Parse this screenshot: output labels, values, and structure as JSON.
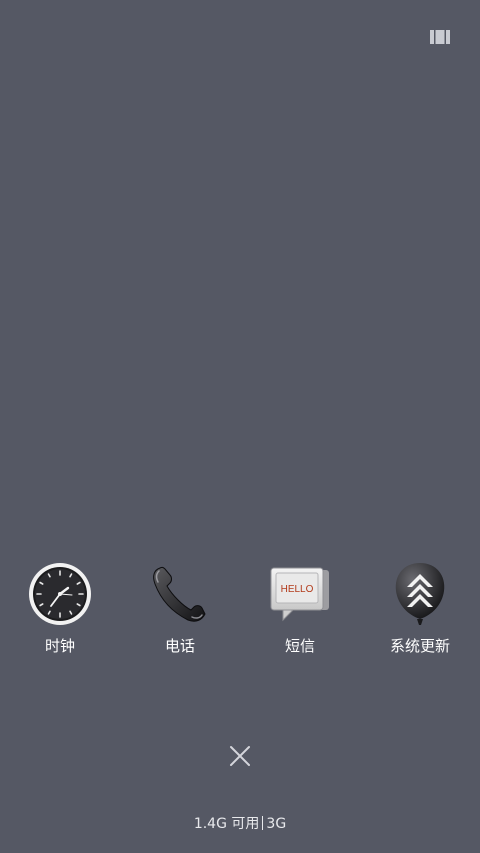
{
  "apps": [
    {
      "label": "时钟",
      "icon": "clock-icon"
    },
    {
      "label": "电话",
      "icon": "phone-icon"
    },
    {
      "label": "短信",
      "icon": "messages-icon",
      "icon_text": "HELLO"
    },
    {
      "label": "系统更新",
      "icon": "system-update-icon"
    }
  ],
  "footer": {
    "memory_available": "1.4G 可用",
    "network": "3G"
  },
  "colors": {
    "background": "#555864",
    "text": "#ffffff"
  }
}
